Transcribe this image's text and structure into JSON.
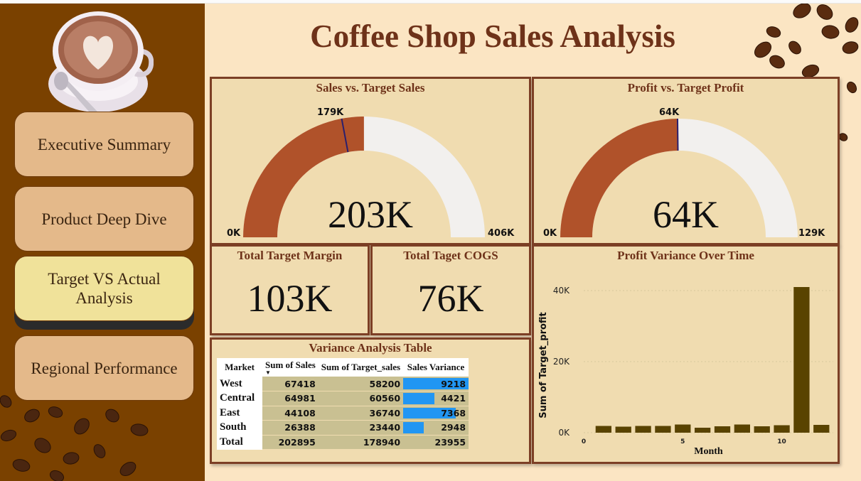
{
  "page": {
    "title": "Coffee Shop Sales Analysis"
  },
  "nav": {
    "items": [
      {
        "label": "Executive Summary",
        "active": false
      },
      {
        "label": "Product Deep Dive",
        "active": false
      },
      {
        "label": "Target VS Actual Analysis",
        "active": true
      },
      {
        "label": "Regional Performance",
        "active": false
      }
    ]
  },
  "colors": {
    "gauge_fill": "#b0522a",
    "gauge_bg": "#f2f0ee",
    "target_line": "#2a1f6e",
    "bar_color": "#594300",
    "variance_bar": "#2196f3"
  },
  "gauges": [
    {
      "title": "Sales vs. Target Sales",
      "value_label": "203K",
      "min_label": "0K",
      "max_label": "406K",
      "target_label": "179K",
      "value": 202895,
      "max": 406000,
      "target": 178940
    },
    {
      "title": "Profit vs. Target Profit",
      "value_label": "64K",
      "min_label": "0K",
      "max_label": "129K",
      "target_label": "64K",
      "value": 64000,
      "max": 129000,
      "target": 64000
    }
  ],
  "kpis": [
    {
      "title": "Total Target Margin",
      "value": "103K"
    },
    {
      "title": "Total Taget COGS",
      "value": "76K"
    }
  ],
  "variance_table": {
    "title": "Variance Analysis Table",
    "headers": [
      "Market",
      "Sum of Sales",
      "Sum of Target_sales",
      "Sales Variance"
    ],
    "rows": [
      {
        "market": "West",
        "sales": "67418",
        "target": "58200",
        "variance": "9218",
        "variance_value": 9218
      },
      {
        "market": "Central",
        "sales": "64981",
        "target": "60560",
        "variance": "4421",
        "variance_value": 4421
      },
      {
        "market": "East",
        "sales": "44108",
        "target": "36740",
        "variance": "7368",
        "variance_value": 7368
      },
      {
        "market": "South",
        "sales": "26388",
        "target": "23440",
        "variance": "2948",
        "variance_value": 2948
      }
    ],
    "total": {
      "market": "Total",
      "sales": "202895",
      "target": "178940",
      "variance": "23955"
    },
    "variance_max": 9218
  },
  "chart_data": {
    "type": "bar",
    "title": "Profit Variance Over Time",
    "xlabel": "Month",
    "ylabel": "Sum of Target_profit",
    "x": [
      1,
      2,
      3,
      4,
      5,
      6,
      7,
      8,
      9,
      10,
      11,
      12
    ],
    "values": [
      1900,
      1700,
      1900,
      1900,
      2300,
      1400,
      1800,
      2300,
      1800,
      2100,
      41000,
      2200
    ],
    "x_ticks": [
      "0",
      "5",
      "10"
    ],
    "x_tick_values": [
      0,
      5,
      10
    ],
    "y_ticks": [
      "0K",
      "20K",
      "40K"
    ],
    "y_tick_values": [
      0,
      20000,
      40000
    ],
    "ylim": [
      0,
      46000
    ],
    "xlim": [
      0,
      12.6
    ],
    "grid": true
  }
}
